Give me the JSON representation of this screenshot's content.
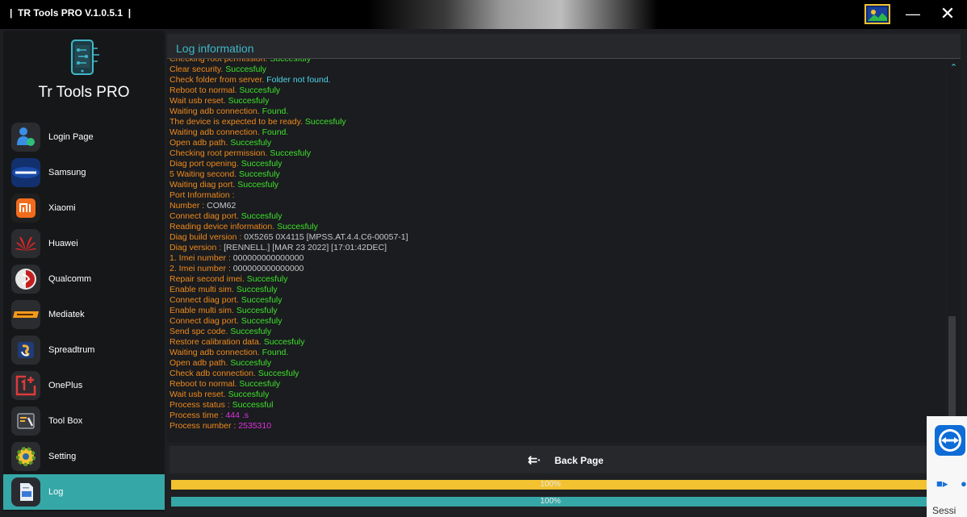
{
  "window": {
    "title": "|  TR Tools PRO V.1.0.5.1  |"
  },
  "sidebar": {
    "app_name": "Tr Tools PRO",
    "items": [
      {
        "label": "Login Page",
        "icon": "user-icon"
      },
      {
        "label": "Samsung",
        "icon": "samsung-icon"
      },
      {
        "label": "Xiaomi",
        "icon": "xiaomi-icon"
      },
      {
        "label": "Huawei",
        "icon": "huawei-icon"
      },
      {
        "label": "Qualcomm",
        "icon": "qualcomm-icon"
      },
      {
        "label": "Mediatek",
        "icon": "mediatek-icon"
      },
      {
        "label": "Spreadtrum",
        "icon": "spreadtrum-icon"
      },
      {
        "label": "OnePlus",
        "icon": "oneplus-icon"
      },
      {
        "label": "Tool Box",
        "icon": "toolbox-icon"
      },
      {
        "label": "Setting",
        "icon": "gear-icon"
      },
      {
        "label": "Log",
        "icon": "log-icon",
        "active": true
      }
    ]
  },
  "log": {
    "header": "Log information",
    "lines": [
      [
        [
          "Checking root permission. ",
          "o"
        ],
        [
          "Succesfuly",
          "g"
        ]
      ],
      [
        [
          "Clear security. ",
          "o"
        ],
        [
          "Succesfuly",
          "g"
        ]
      ],
      [
        [
          "Check folder from server. ",
          "o"
        ],
        [
          "Folder not found.",
          "c"
        ]
      ],
      [
        [
          "Reboot to normal. ",
          "o"
        ],
        [
          "Succesfuly",
          "g"
        ]
      ],
      [
        [
          "Wait usb reset. ",
          "o"
        ],
        [
          "Succesfuly",
          "g"
        ]
      ],
      [
        [
          "Waiting adb connection. ",
          "o"
        ],
        [
          "Found.",
          "g"
        ]
      ],
      [
        [
          "The device is expected to be ready. ",
          "o"
        ],
        [
          "Succesfuly",
          "g"
        ]
      ],
      [
        [
          "Waiting adb connection. ",
          "o"
        ],
        [
          "Found.",
          "g"
        ]
      ],
      [
        [
          "Open adb path. ",
          "o"
        ],
        [
          "Succesfuly",
          "g"
        ]
      ],
      [
        [
          "Checking root permission. ",
          "o"
        ],
        [
          "Succesfuly",
          "g"
        ]
      ],
      [
        [
          "Diag port opening. ",
          "o"
        ],
        [
          "Succesfuly",
          "g"
        ]
      ],
      [
        [
          "5 Waiting second. ",
          "o"
        ],
        [
          "Succesfuly",
          "g"
        ]
      ],
      [
        [
          "Waiting diag port. ",
          "o"
        ],
        [
          "Succesfuly",
          "g"
        ]
      ],
      [
        [
          "Port Information :",
          "o"
        ]
      ],
      [
        [
          "Number :  ",
          "o"
        ],
        [
          "COM62",
          "w"
        ]
      ],
      [
        [
          "Connect diag port. ",
          "o"
        ],
        [
          "Succesfuly",
          "g"
        ]
      ],
      [
        [
          "Reading device information. ",
          "o"
        ],
        [
          "Succesfuly",
          "g"
        ]
      ],
      [
        [
          "Diag build version :  ",
          "o"
        ],
        [
          "0X5265 0X4115 [MPSS.AT.4.4.C6-00057-1]",
          "w"
        ]
      ],
      [
        [
          "Diag version :  ",
          "o"
        ],
        [
          "[RENNELL.] [MAR 23 2022] [17:01:42DEC]",
          "w"
        ]
      ],
      [
        [
          "1. Imei number :  ",
          "o"
        ],
        [
          "000000000000000",
          "w"
        ]
      ],
      [
        [
          "2. Imei number :  ",
          "o"
        ],
        [
          "000000000000000",
          "w"
        ]
      ],
      [
        [
          "Repair second imei. ",
          "o"
        ],
        [
          "Succesfuly",
          "g"
        ]
      ],
      [
        [
          "Enable multi sim. ",
          "o"
        ],
        [
          "Succesfuly",
          "g"
        ]
      ],
      [
        [
          "Connect diag port. ",
          "o"
        ],
        [
          "Succesfuly",
          "g"
        ]
      ],
      [
        [
          "Enable multi sim. ",
          "o"
        ],
        [
          "Succesfuly",
          "g"
        ]
      ],
      [
        [
          "Connect diag port. ",
          "o"
        ],
        [
          "Succesfuly",
          "g"
        ]
      ],
      [
        [
          "Send spc code. ",
          "o"
        ],
        [
          "Succesfuly",
          "g"
        ]
      ],
      [
        [
          "Restore calibration data. ",
          "o"
        ],
        [
          "Succesfuly",
          "g"
        ]
      ],
      [
        [
          "Waiting adb connection. ",
          "o"
        ],
        [
          "Found.",
          "g"
        ]
      ],
      [
        [
          "Open adb path. ",
          "o"
        ],
        [
          "Succesfuly",
          "g"
        ]
      ],
      [
        [
          "Check adb connection. ",
          "o"
        ],
        [
          "Succesfuly",
          "g"
        ]
      ],
      [
        [
          "Reboot to normal. ",
          "o"
        ],
        [
          "Succesfuly",
          "g"
        ]
      ],
      [
        [
          "Wait usb reset. ",
          "o"
        ],
        [
          "Succesfuly",
          "g"
        ]
      ],
      [
        [
          "Process status :  ",
          "o"
        ],
        [
          "Successful",
          "g"
        ]
      ],
      [
        [
          "Process time :  ",
          "o"
        ],
        [
          "444 .s",
          "m"
        ]
      ],
      [
        [
          "Process number :  ",
          "o"
        ],
        [
          "2535310",
          "m"
        ]
      ]
    ]
  },
  "footer": {
    "back_label": "Back Page",
    "progress1_text": "100%",
    "progress2_text": "100%",
    "progress1_value": 1.0,
    "progress2_value": 1.0
  },
  "teamviewer": {
    "session_text": "Sessi"
  },
  "colors": {
    "accent": "#36a7a7",
    "log_orange": "#f08a1c",
    "log_green": "#3ee22a",
    "log_cyan": "#4ed4e8",
    "log_magenta": "#e030e0",
    "progress_yellow": "#f2c230"
  }
}
